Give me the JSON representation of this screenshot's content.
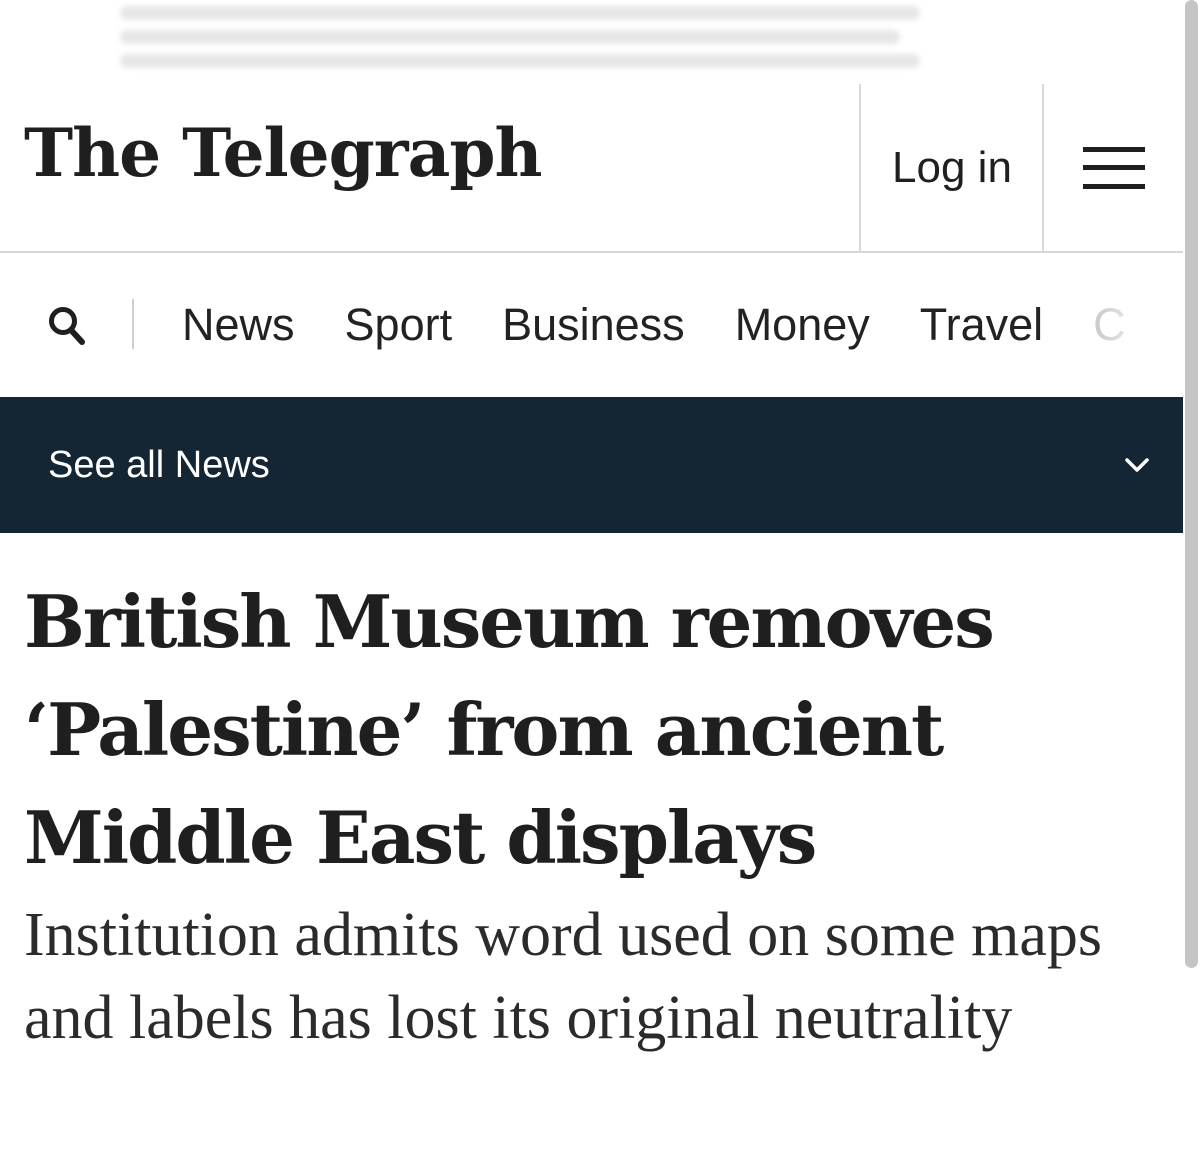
{
  "header": {
    "logo_text": "The Telegraph",
    "login_label": "Log in",
    "menu_icon": "hamburger-menu-icon"
  },
  "nav": {
    "search_icon": "search-icon",
    "items": [
      "News",
      "Sport",
      "Business",
      "Money",
      "Travel",
      "C"
    ]
  },
  "section_bar": {
    "label": "See all News",
    "chevron_icon": "chevron-down-icon",
    "background": "#142633"
  },
  "article": {
    "headline": "British Museum removes ‘Palestine’ from ancient Middle East displays",
    "standfirst": "Institution admits word used on some maps and labels has lost its original neutrality"
  }
}
